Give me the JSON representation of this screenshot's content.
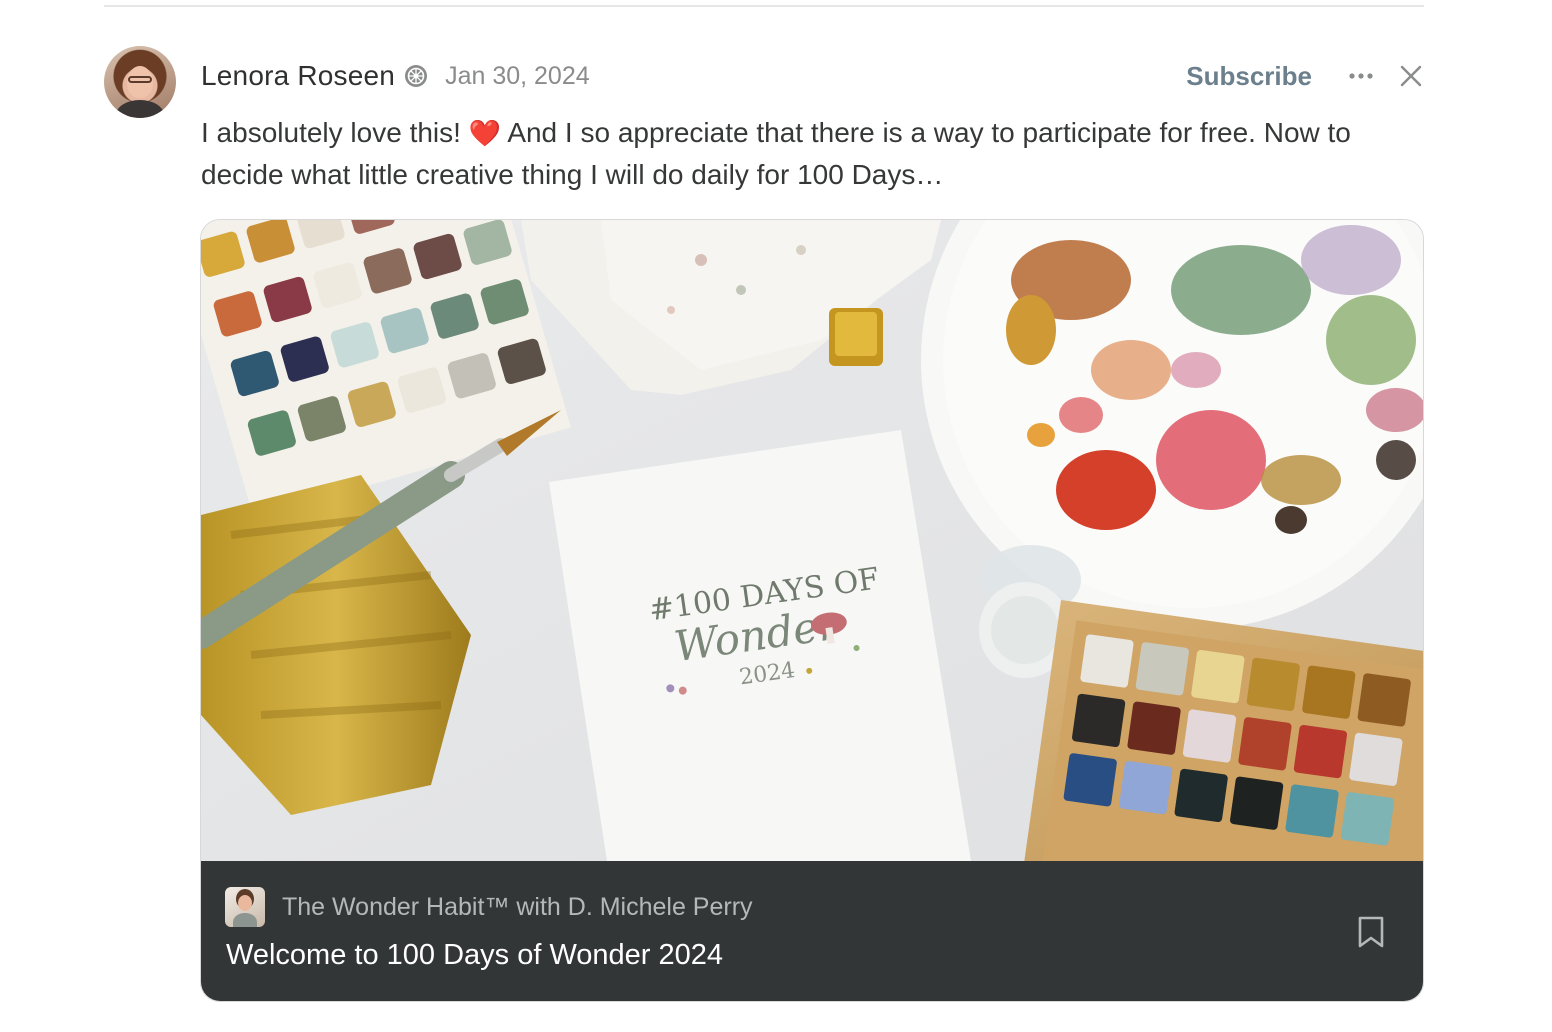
{
  "note": {
    "author": "Lenora Roseen",
    "date": "Jan 30, 2024",
    "subscribe_label": "Subscribe",
    "body_part1": "I absolutely love this! ",
    "heart": "❤️",
    "body_part2": " And I so appreciate that there is a way to participate for free. Now to decide what little creative thing I will do daily for 100 Days…",
    "icons": [
      "verified-badge-icon",
      "more-icon",
      "close-icon"
    ]
  },
  "card": {
    "publication_name": "The Wonder Habit™ with D. Michele Perry",
    "post_title": "Welcome to 100 Days of Wonder 2024",
    "image_text_line1": "#100 DAYS OF",
    "image_text_line2": "Wonder",
    "image_text_line3": "2024",
    "icons": [
      "bookmark-icon"
    ]
  }
}
